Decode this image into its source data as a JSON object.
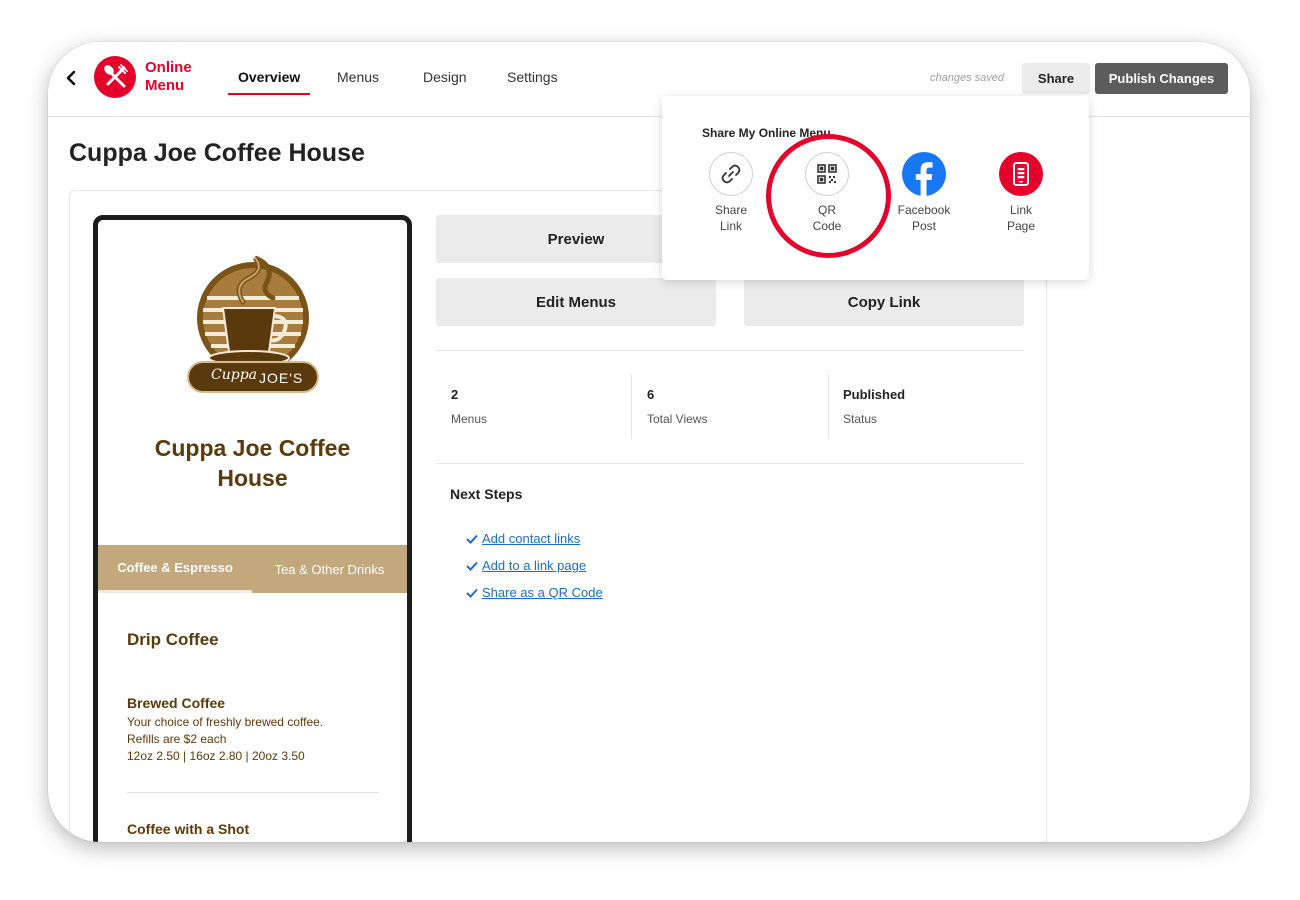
{
  "header": {
    "brand_line1": "Online",
    "brand_line2": "Menu",
    "tabs": [
      "Overview",
      "Menus",
      "Design",
      "Settings"
    ],
    "status": "changes saved",
    "share_label": "Share",
    "publish_label": "Publish Changes"
  },
  "page": {
    "title": "Cuppa Joe Coffee House"
  },
  "preview": {
    "logo_text_1": "Cuppa",
    "logo_text_2": "JOE'S",
    "restaurant_name": "Cuppa Joe Coffee House",
    "categories": [
      "Coffee & Espresso",
      "Tea & Other Drinks"
    ],
    "section_title": "Drip Coffee",
    "items": [
      {
        "name": "Brewed Coffee",
        "desc1": "Your choice of freshly brewed coffee.",
        "desc2": "Refills are $2 each",
        "prices": "12oz 2.50 | 16oz 2.80 | 20oz 3.50"
      },
      {
        "name": "Coffee with a Shot"
      }
    ]
  },
  "actions": {
    "preview": "Preview",
    "edit_menus": "Edit Menus",
    "copy_link": "Copy Link"
  },
  "stats": [
    {
      "value": "2",
      "label": "Menus"
    },
    {
      "value": "6",
      "label": "Total Views"
    },
    {
      "value": "Published",
      "label": "Status"
    }
  ],
  "next_steps": {
    "title": "Next Steps",
    "items": [
      "Add contact links",
      "Add to a link page",
      "Share as a QR Code"
    ]
  },
  "share_popover": {
    "title": "Share My Online Menu",
    "options": [
      {
        "line1": "Share",
        "line2": "Link",
        "icon": "link-icon"
      },
      {
        "line1": "QR",
        "line2": "Code",
        "icon": "qr-code-icon"
      },
      {
        "line1": "Facebook",
        "line2": "Post",
        "icon": "facebook-icon"
      },
      {
        "line1": "Link",
        "line2": "Page",
        "icon": "link-page-icon"
      }
    ]
  },
  "colors": {
    "accent": "#e4002b",
    "brown": "#5b3a0b",
    "tab_bar": "#c3a87d",
    "link": "#1a6fc4",
    "facebook": "#1877f2"
  }
}
